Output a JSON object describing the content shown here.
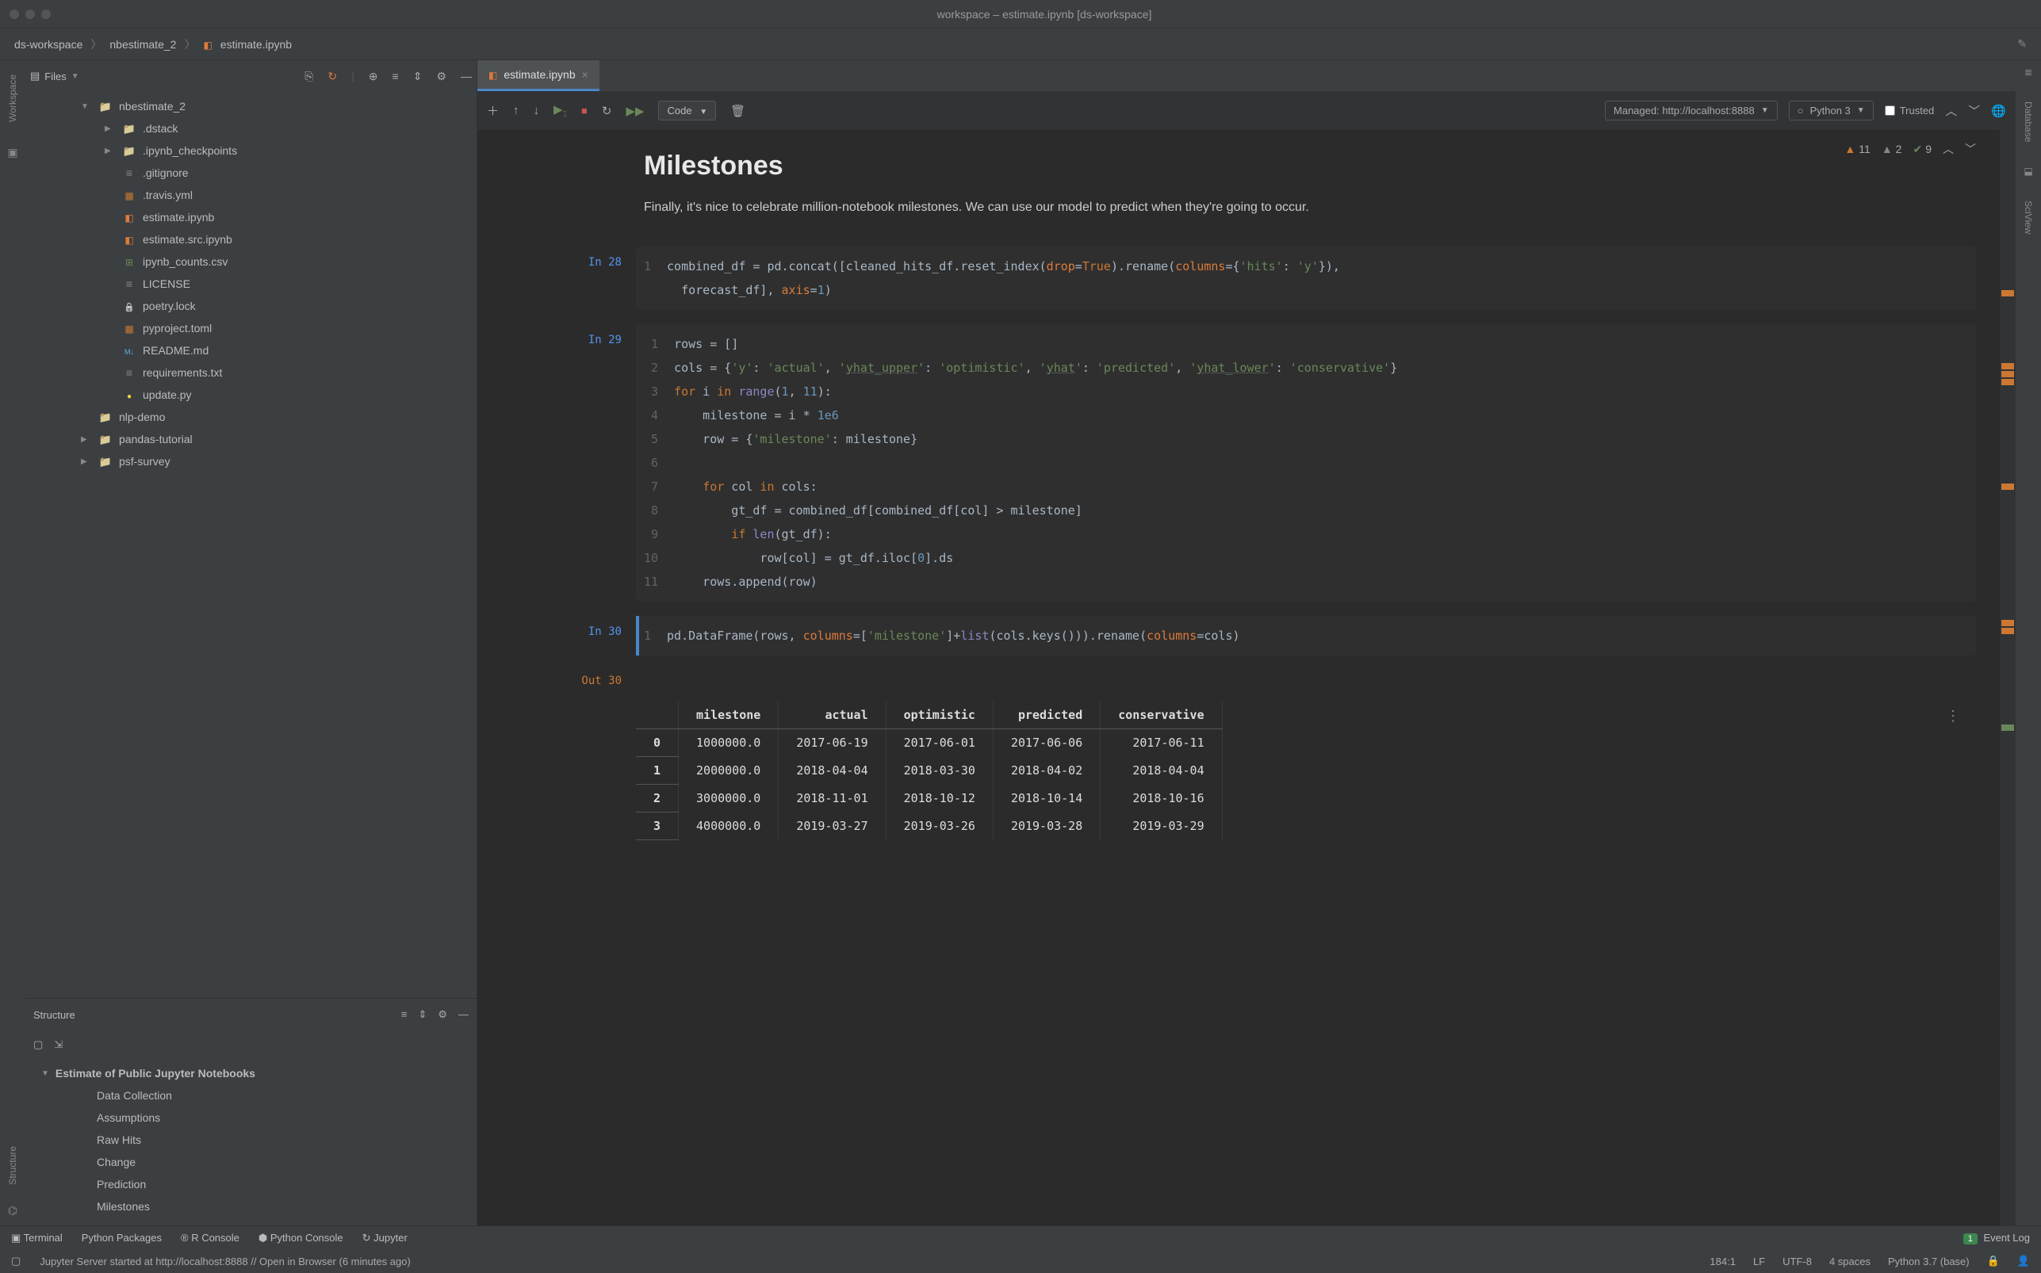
{
  "window_title": "workspace – estimate.ipynb [ds-workspace]",
  "breadcrumbs": {
    "root": "ds-workspace",
    "mid": "nbestimate_2",
    "file": "estimate.ipynb"
  },
  "sidebar": {
    "files_label": "Files"
  },
  "left_tabs": {
    "workspace": "Workspace",
    "structure": "Structure"
  },
  "right_tabs": {
    "database": "Database",
    "sciview": "SciView"
  },
  "tree": [
    {
      "t": "folder",
      "l": "nbestimate_2",
      "d": 1,
      "open": true
    },
    {
      "t": "folder",
      "l": ".dstack",
      "d": 2,
      "open": false,
      "chev": true
    },
    {
      "t": "folder",
      "l": ".ipynb_checkpoints",
      "d": 2,
      "open": false,
      "chev": true
    },
    {
      "t": "txt",
      "l": ".gitignore",
      "d": 2
    },
    {
      "t": "json",
      "l": ".travis.yml",
      "d": 2
    },
    {
      "t": "nb",
      "l": "estimate.ipynb",
      "d": 2
    },
    {
      "t": "nb",
      "l": "estimate.src.ipynb",
      "d": 2
    },
    {
      "t": "csv",
      "l": "ipynb_counts.csv",
      "d": 2
    },
    {
      "t": "txt",
      "l": "LICENSE",
      "d": 2
    },
    {
      "t": "lock",
      "l": "poetry.lock",
      "d": 2
    },
    {
      "t": "json",
      "l": "pyproject.toml",
      "d": 2
    },
    {
      "t": "md",
      "l": "README.md",
      "d": 2
    },
    {
      "t": "txt",
      "l": "requirements.txt",
      "d": 2
    },
    {
      "t": "py",
      "l": "update.py",
      "d": 2
    },
    {
      "t": "folder",
      "l": "nlp-demo",
      "d": 1
    },
    {
      "t": "folder",
      "l": "pandas-tutorial",
      "d": 1,
      "chev": true
    },
    {
      "t": "folder",
      "l": "psf-survey",
      "d": 1,
      "chev": true
    }
  ],
  "structure": {
    "title": "Structure",
    "root": "Estimate of Public Jupyter Notebooks",
    "items": [
      "Data Collection",
      "Assumptions",
      "Raw Hits",
      "Change",
      "Prediction",
      "Milestones"
    ]
  },
  "tab": {
    "name": "estimate.ipynb"
  },
  "nb_toolbar": {
    "celltype": "Code",
    "managed": "Managed: http://localhost:8888",
    "kernel": "Python 3",
    "trusted": "Trusted"
  },
  "top_status": {
    "warn": "11",
    "weak": "2",
    "check": "9"
  },
  "md": {
    "heading": "Milestones",
    "para": "Finally, it's nice to celebrate million-notebook milestones. We can use our model to predict when they're going to occur."
  },
  "cells": {
    "c28_prompt": "In 28",
    "c29_prompt": "In 29",
    "c30_prompt": "In 30",
    "out30_prompt": "Out 30"
  },
  "table": {
    "cols": [
      "",
      "milestone",
      "actual",
      "optimistic",
      "predicted",
      "conservative"
    ],
    "rows": [
      [
        "0",
        "1000000.0",
        "2017-06-19",
        "2017-06-01",
        "2017-06-06",
        "2017-06-11"
      ],
      [
        "1",
        "2000000.0",
        "2018-04-04",
        "2018-03-30",
        "2018-04-02",
        "2018-04-04"
      ],
      [
        "2",
        "3000000.0",
        "2018-11-01",
        "2018-10-12",
        "2018-10-14",
        "2018-10-16"
      ],
      [
        "3",
        "4000000.0",
        "2019-03-27",
        "2019-03-26",
        "2019-03-28",
        "2019-03-29"
      ]
    ]
  },
  "bottom_tools": {
    "terminal": "Terminal",
    "python_packages": "Python Packages",
    "r_console": "R Console",
    "python_console": "Python Console",
    "jupyter": "Jupyter",
    "event_log_count": "1",
    "event_log": "Event Log"
  },
  "statusbar": {
    "msg": "Jupyter Server started at http://localhost:8888 // Open in Browser (6 minutes ago)",
    "pos": "184:1",
    "lf": "LF",
    "enc": "UTF-8",
    "indent": "4 spaces",
    "interp": "Python 3.7 (base)"
  }
}
